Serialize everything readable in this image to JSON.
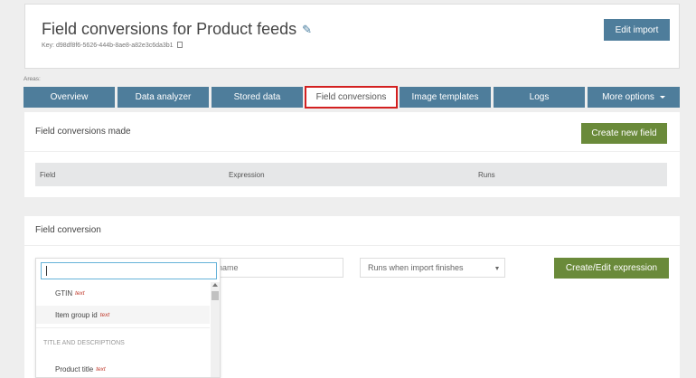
{
  "header": {
    "title": "Field conversions for Product feeds",
    "key_text": "Key: d98df8f6-5626-444b-8ae8-a82e3c6da3b1",
    "edit_import_label": "Edit import"
  },
  "areas_label": "Areas:",
  "tabs": [
    {
      "label": "Overview"
    },
    {
      "label": "Data analyzer"
    },
    {
      "label": "Stored data"
    },
    {
      "label": "Field conversions",
      "active": true
    },
    {
      "label": "Image templates"
    },
    {
      "label": "Logs"
    },
    {
      "label": "More options"
    }
  ],
  "conversions_made": {
    "title": "Field conversions made",
    "create_button": "Create new field",
    "columns": [
      "Field",
      "Expression",
      "Runs"
    ]
  },
  "field_conversion": {
    "title": "Field conversion",
    "custom_name_placeholder": "om name",
    "runs_selected": "Runs when import finishes",
    "create_expression_button": "Create/Edit expression"
  },
  "dropdown": {
    "search_value": "",
    "items": [
      {
        "label": "GTIN",
        "type": "text"
      },
      {
        "label": "Item group id",
        "type": "text"
      }
    ],
    "group_label": "TITLE AND DESCRIPTIONS",
    "group_items": [
      {
        "label": "Product title",
        "type": "text"
      }
    ]
  },
  "colors": {
    "tab_blue": "#4e7d9b",
    "green_button": "#6a8a3a",
    "active_tab_border": "#d32020",
    "type_red": "#c0392b"
  }
}
